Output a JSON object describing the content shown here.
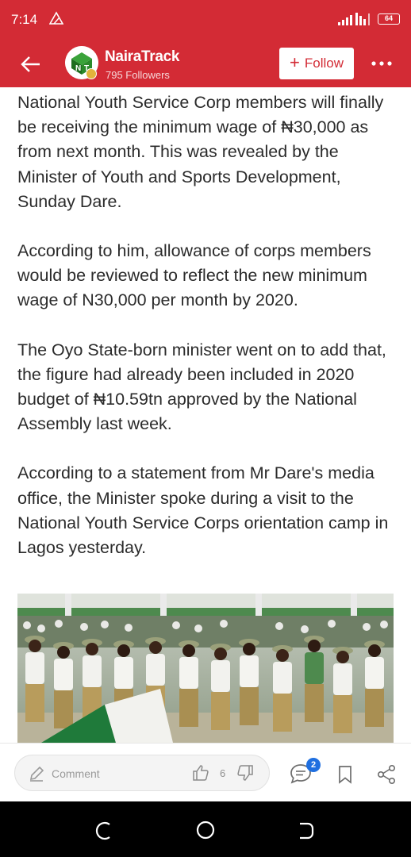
{
  "status_bar": {
    "time": "7:14",
    "battery": "64"
  },
  "header": {
    "channel_name": "NairaTrack",
    "followers": "795 Followers",
    "follow_label": "Follow",
    "accent_color": "#d32b35"
  },
  "article": {
    "paragraphs": [
      "National Youth Service Corp members will finally be receiving the minimum wage of ₦30,000 as from next month. This was revealed by the Minister of Youth and Sports Development, Sunday Dare.",
      "According to him, allowance of corps members would be reviewed to reflect the new minimum wage of N30,000 per month by 2020.",
      "The Oyo State-born minister went on to add that, the figure had already been included in 2020 budget of ₦10.59tn approved by the National Assembly last week.",
      "According to a statement from Mr Dare's media office, the Minister spoke during a visit to the National Youth Service Corps orientation camp in Lagos yesterday."
    ]
  },
  "action_bar": {
    "comment_placeholder": "Comment",
    "like_count": "6",
    "comments_badge": "2",
    "badge_color": "#1f6fe0"
  },
  "icons": {
    "back": "back-arrow-icon",
    "more": "more-dots-icon",
    "comment": "pencil-icon",
    "like": "thumbs-up-icon",
    "dislike": "thumbs-down-icon",
    "chat": "chat-bubble-icon",
    "bookmark": "bookmark-icon",
    "share": "share-icon"
  }
}
